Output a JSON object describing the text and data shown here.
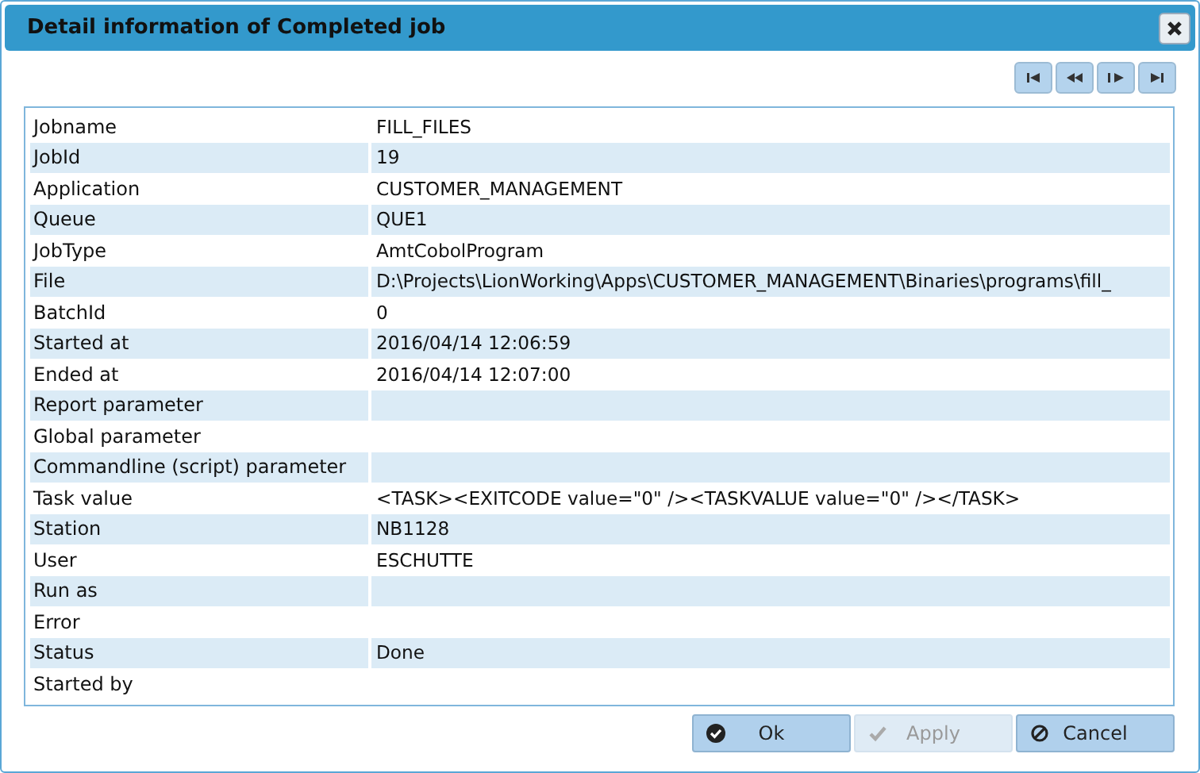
{
  "window": {
    "title": "Detail information of Completed job"
  },
  "nav_buttons": [
    {
      "kind": "first"
    },
    {
      "kind": "prev"
    },
    {
      "kind": "next"
    },
    {
      "kind": "last"
    }
  ],
  "fields": [
    {
      "label": "Jobname",
      "value": "FILL_FILES"
    },
    {
      "label": "JobId",
      "value": "19"
    },
    {
      "label": "Application",
      "value": "CUSTOMER_MANAGEMENT"
    },
    {
      "label": "Queue",
      "value": "QUE1"
    },
    {
      "label": "JobType",
      "value": "AmtCobolProgram"
    },
    {
      "label": "File",
      "value": "D:\\Projects\\LionWorking\\Apps\\CUSTOMER_MANAGEMENT\\Binaries\\programs\\fill_"
    },
    {
      "label": "BatchId",
      "value": "0"
    },
    {
      "label": "Started at",
      "value": "2016/04/14 12:06:59"
    },
    {
      "label": "Ended at",
      "value": "2016/04/14 12:07:00"
    },
    {
      "label": "Report parameter"
    },
    {
      "label": "Global parameter"
    },
    {
      "label": "Commandline (script) parameter"
    },
    {
      "label": "Task value",
      "value": "<TASK><EXITCODE value=\"0\" /><TASKVALUE value=\"0\" /></TASK>"
    },
    {
      "label": "Station",
      "value": "NB1128"
    },
    {
      "label": "User",
      "value": "ESCHUTTE"
    },
    {
      "label": "Run as"
    },
    {
      "label": "Error"
    },
    {
      "label": "Status",
      "value": "Done"
    },
    {
      "label": "Started by"
    }
  ],
  "buttons": [
    {
      "kind": "ok",
      "label": "Ok",
      "disabled": false
    },
    {
      "kind": "apply",
      "label": "Apply",
      "disabled": true
    },
    {
      "kind": "cancel",
      "label": "Cancel",
      "disabled": false
    }
  ]
}
